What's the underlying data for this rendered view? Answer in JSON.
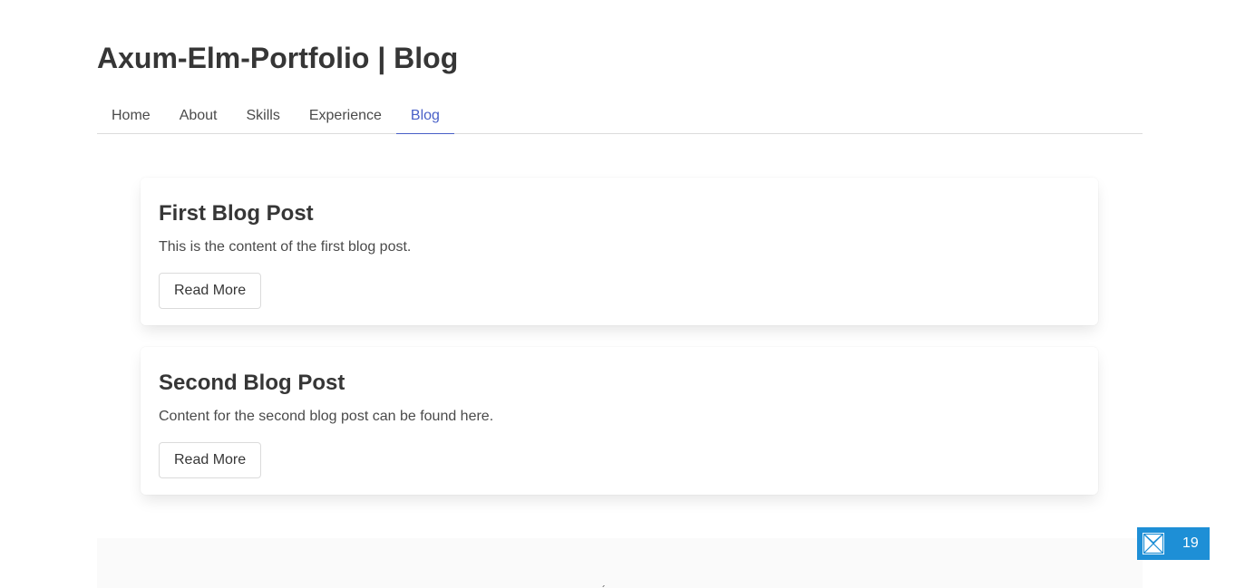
{
  "header": {
    "title": "Axum-Elm-Portfolio | Blog"
  },
  "nav": {
    "tabs": [
      {
        "label": "Home",
        "active": false
      },
      {
        "label": "About",
        "active": false
      },
      {
        "label": "Skills",
        "active": false
      },
      {
        "label": "Experience",
        "active": false
      },
      {
        "label": "Blog",
        "active": true
      }
    ]
  },
  "posts": [
    {
      "title": "First Blog Post",
      "content": "This is the content of the first blog post.",
      "button_label": "Read More"
    },
    {
      "title": "Second Blog Post",
      "content": "Content for the second blog post can be found here.",
      "button_label": "Read More"
    }
  ],
  "footer": {
    "partial_glyph": "´"
  },
  "badge": {
    "icon": "envelope-x-icon",
    "count": "19"
  },
  "colors": {
    "accent": "#485fc7",
    "text": "#363636",
    "border": "#dbdbdb",
    "footer_bg": "#fafafa",
    "badge_bg": "#1e8fd6"
  }
}
